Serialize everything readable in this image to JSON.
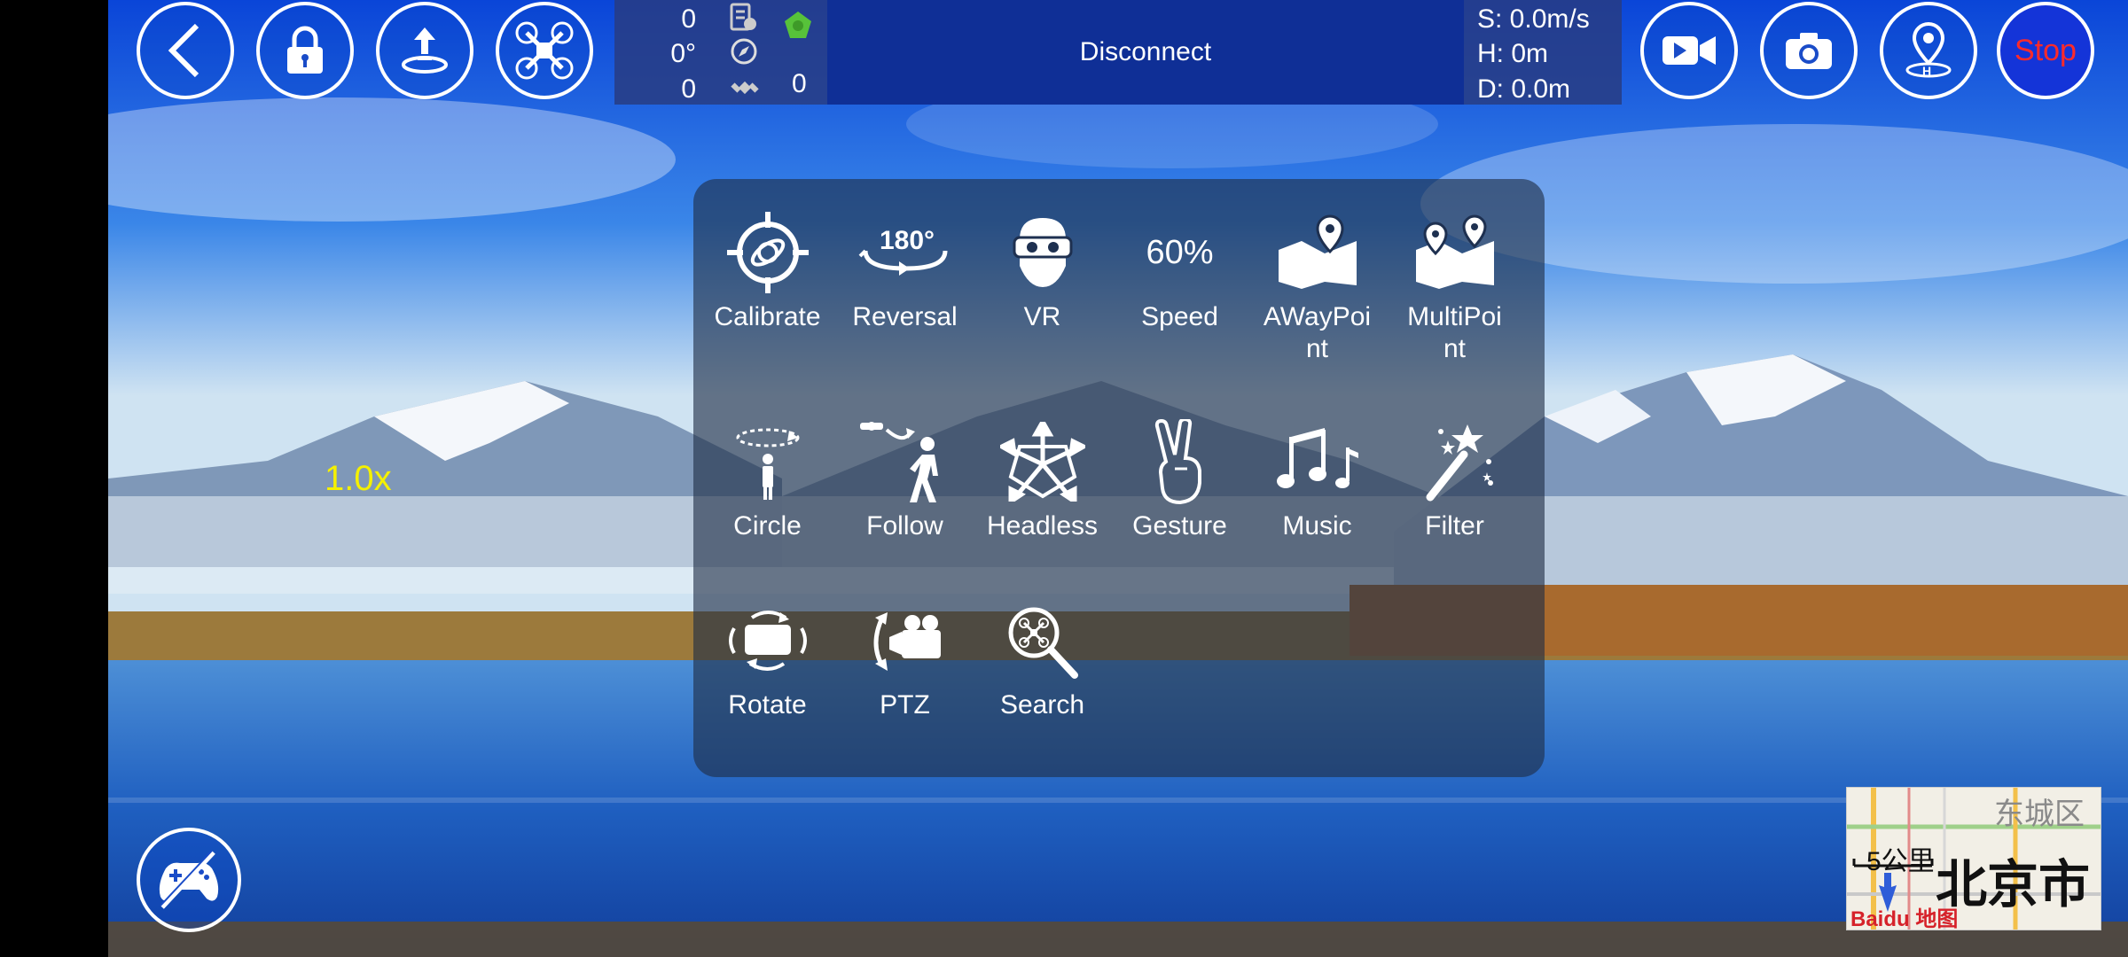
{
  "toolbar_left": {
    "back": "back-icon",
    "lock": "lock-icon",
    "takeoff": "takeoff-icon",
    "drone": "drone-icon"
  },
  "telemetry": {
    "value_top": "0",
    "heading": "0°",
    "value_bottom": "0",
    "satellites": "0"
  },
  "connection": {
    "status": "Disconnect"
  },
  "flight": {
    "speed": "S: 0.0m/s",
    "height": "H: 0m",
    "distance": "D: 0.0m"
  },
  "toolbar_right": {
    "video": "video-camera-icon",
    "photo": "camera-icon",
    "location": "location-pin-icon",
    "stop_label": "Stop"
  },
  "zoom": "1.0x",
  "menu": {
    "row1": [
      {
        "label": "Calibrate",
        "icon": "calibrate-icon"
      },
      {
        "label": "Reversal",
        "icon": "reversal-180-icon"
      },
      {
        "label": "VR",
        "icon": "vr-headset-icon"
      },
      {
        "label": "60%",
        "icon": "speed-text",
        "sublabel": "Speed"
      },
      {
        "label": "AWayPoint",
        "icon": "single-waypoint-map-icon"
      },
      {
        "label": "MultiPoint",
        "icon": "multi-waypoint-map-icon"
      }
    ],
    "labels_row1": [
      "Calibrate",
      "Reversal",
      "VR",
      "Speed",
      "AWayPoi\nnt",
      "MultiPoi\nnt"
    ],
    "speed_value": "60%",
    "labels_row2": [
      "Circle",
      "Follow",
      "Headless",
      "Gesture",
      "Music",
      "Filter"
    ],
    "labels_row3": [
      "Rotate",
      "PTZ",
      "Search"
    ]
  },
  "minimap": {
    "district": "东城区",
    "city": "北京市",
    "scale": "5公里",
    "brand": "Baidu 地图"
  },
  "colors": {
    "stop_text": "#ff2a2a",
    "zoom_text": "#f4f000",
    "disconnect_bar": "#0f2f96"
  }
}
